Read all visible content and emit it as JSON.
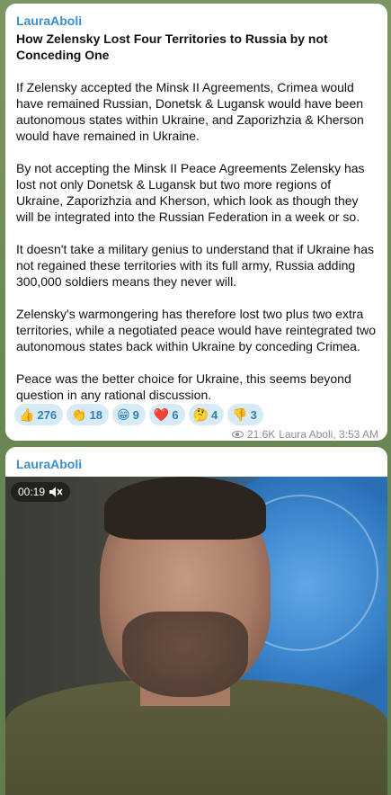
{
  "post1": {
    "author": "LauraAboli",
    "title": "How Zelensky Lost Four Territories to Russia by not Conceding One",
    "paragraphs": [
      "If Zelensky accepted the Minsk II Agreements, Crimea would have remained Russian, Donetsk & Lugansk would have been autonomous states within Ukraine, and Zaporizhzia & Kherson would have remained in Ukraine.",
      "By not accepting the Minsk II Peace Agreements Zelensky has lost not only Donetsk & Lugansk but two more regions of Ukraine, Zaporizhzia and Kherson, which look as though they will be integrated into the Russian Federation in a week or so.",
      "It doesn't take a military genius to understand that if Ukraine has not regained these territories with its full army, Russia adding 300,000 soldiers means they never will.",
      "Zelensky's warmongering has therefore lost two plus two extra territories, while a negotiated peace would have reintegrated two autonomous states back within Ukraine by conceding Crimea.",
      "Peace was the better choice for Ukraine, this seems beyond question in any rational discussion."
    ],
    "reactions": [
      {
        "emoji": "👍",
        "icon": "thumbs-up-icon",
        "count": "276"
      },
      {
        "emoji": "👏",
        "icon": "clapping-hands-icon",
        "count": "18"
      },
      {
        "emoji": "😁",
        "icon": "grinning-face-icon",
        "count": "9"
      },
      {
        "emoji": "❤️",
        "icon": "red-heart-icon",
        "count": "6"
      },
      {
        "emoji": "🤔",
        "icon": "thinking-face-icon",
        "count": "4"
      },
      {
        "emoji": "👎",
        "icon": "thumbs-down-icon",
        "count": "3"
      }
    ],
    "views": "21.6K",
    "signature": "Laura Aboli, 3:53 AM"
  },
  "post2": {
    "author": "LauraAboli",
    "video_time": "00:19",
    "icons": {
      "mute": "speaker-muted-icon",
      "views": "eye-icon"
    }
  },
  "colors": {
    "author": "#3a8fc8",
    "reaction_bg": "#d7ebf7",
    "reaction_text": "#2f7fb6",
    "meta_text": "#8b8f94",
    "chat_background": "#6e8a58"
  }
}
